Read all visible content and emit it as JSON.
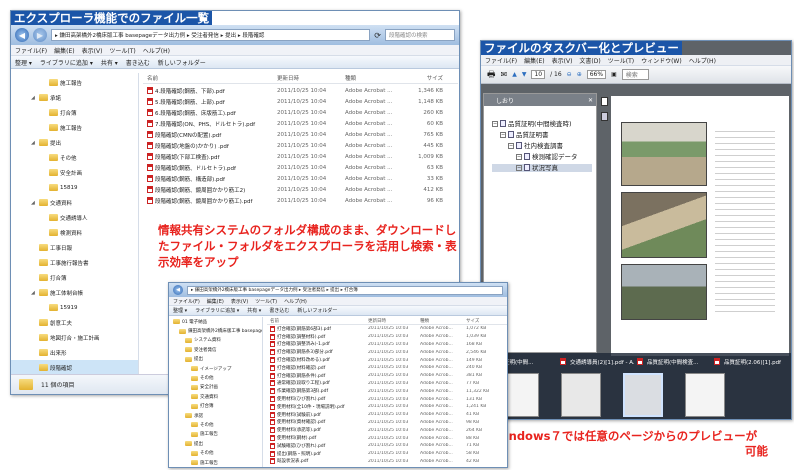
{
  "explorer_main": {
    "heading": "エクスプローラ機能でのファイル一覧",
    "address": "▸ 鎌田高架橋外2橋床版工事 basepageデータ出力例 ▸ 受注者発信 ▸ 提出 ▸ 段階確認",
    "search_placeholder": "段階確認の検索",
    "menu": [
      "ファイル(F)",
      "編集(E)",
      "表示(V)",
      "ツール(T)",
      "ヘルプ(H)"
    ],
    "commands": [
      "整理 ▾",
      "ライブラリに追加 ▾",
      "共有 ▾",
      "書き込む",
      "新しいフォルダー"
    ],
    "tree": [
      {
        "label": "施工報告",
        "level": 2,
        "exp": ""
      },
      {
        "label": "承諾",
        "level": 1,
        "exp": "◢"
      },
      {
        "label": "打合簿",
        "level": 2,
        "exp": ""
      },
      {
        "label": "施工報告",
        "level": 2,
        "exp": ""
      },
      {
        "label": "提出",
        "level": 1,
        "exp": "◢"
      },
      {
        "label": "その他",
        "level": 2,
        "exp": ""
      },
      {
        "label": "安全計画",
        "level": 2,
        "exp": ""
      },
      {
        "label": "15819",
        "level": 2,
        "exp": ""
      },
      {
        "label": "交通資料",
        "level": 1,
        "exp": "◢"
      },
      {
        "label": "交通誘導人",
        "level": 2,
        "exp": ""
      },
      {
        "label": "検測資料",
        "level": 2,
        "exp": ""
      },
      {
        "label": "工事日報",
        "level": 1,
        "exp": ""
      },
      {
        "label": "工事施行報告書",
        "level": 1,
        "exp": ""
      },
      {
        "label": "打合簿",
        "level": 1,
        "exp": ""
      },
      {
        "label": "施工体制台帳",
        "level": 1,
        "exp": "◢"
      },
      {
        "label": "15919",
        "level": 2,
        "exp": ""
      },
      {
        "label": "創意工夫",
        "level": 1,
        "exp": ""
      },
      {
        "label": "地図打合・施工計画",
        "level": 1,
        "exp": ""
      },
      {
        "label": "出来形",
        "level": 1,
        "exp": ""
      },
      {
        "label": "段階確認",
        "level": 1,
        "exp": "",
        "selected": true
      },
      {
        "label": "品質証明",
        "level": 1,
        "exp": ""
      },
      {
        "label": "報告",
        "level": 0,
        "exp": "◢"
      },
      {
        "label": "近隣・事後状態報告書",
        "level": 1,
        "exp": ""
      }
    ],
    "status": "11 個の項目",
    "columns": [
      "名前",
      "更新日時",
      "種類",
      "サイズ"
    ],
    "files": [
      {
        "name": "4.段階確認(鋼筋、下部).pdf",
        "date": "2011/10/25 10:04",
        "type": "Adobe Acrobat ...",
        "size": "1,346 KB"
      },
      {
        "name": "5.段階確認(鋼筋、上部).pdf",
        "date": "2011/10/25 10:04",
        "type": "Adobe Acrobat ...",
        "size": "1,148 KB"
      },
      {
        "name": "6.段階確認(鋼筋、床版筋工).pdf",
        "date": "2011/10/25 10:04",
        "type": "Adobe Acrobat ...",
        "size": "260 KB"
      },
      {
        "name": "7.段階確認(ON、PHS、ドルセトラ).pdf",
        "date": "2011/10/25 10:04",
        "type": "Adobe Acrobat ...",
        "size": "60 KB"
      },
      {
        "name": "段階確認(CMNの配置).pdf",
        "date": "2011/10/25 10:04",
        "type": "Adobe Acrobat ...",
        "size": "765 KB"
      },
      {
        "name": "段階確認(地盤の)かかり) .pdf",
        "date": "2011/10/25 10:04",
        "type": "Adobe Acrobat ...",
        "size": "445 KB"
      },
      {
        "name": "段階確認(下部工検査).pdf",
        "date": "2011/10/25 10:04",
        "type": "Adobe Acrobat ...",
        "size": "1,009 KB"
      },
      {
        "name": "段階確認(鋼筋、ドルセトラ).pdf",
        "date": "2011/10/25 10:04",
        "type": "Adobe Acrobat ...",
        "size": "63 KB"
      },
      {
        "name": "段階確認(鋼筋、構造部).pdf",
        "date": "2011/10/25 10:04",
        "type": "Adobe Acrobat ...",
        "size": "33 KB"
      },
      {
        "name": "段階確認(鋼筋、鏡周囲かかり筋工2)",
        "date": "2011/10/25 10:04",
        "type": "Adobe Acrobat ...",
        "size": "412 KB"
      },
      {
        "name": "段階確認(鋼筋、鏡周囲かかり筋工).pdf",
        "date": "2011/10/25 10:04",
        "type": "Adobe Acrobat ...",
        "size": "96 KB"
      }
    ]
  },
  "caption_main": "情報共有システムのフォルダ構成のまま、ダウンロードしたファイル・フォルダをエクスプローラを活用し検索・表示効率をアップ",
  "preview_win": {
    "heading": "ファイルのタスクバー化とプレビュー",
    "menu": [
      "ファイル(F)",
      "編集(E)",
      "表示(V)",
      "文書(D)",
      "ツール(T)",
      "ウィンドウ(W)",
      "ヘルプ(H)"
    ],
    "page": "10",
    "pages": "/ 16",
    "zoom": "66%",
    "search": "検索",
    "panel_title": "しおり",
    "bookmarks": [
      {
        "label": "品質証明(中間検査時)",
        "level": 0
      },
      {
        "label": "品質証明書",
        "level": 1
      },
      {
        "label": "社内検査調書",
        "level": 2
      },
      {
        "label": "検測確認データ",
        "level": 3
      },
      {
        "label": "状況写真",
        "level": 3,
        "selected": true
      }
    ],
    "tabs": [
      "品質証明(中間...",
      "交通誘導員(2)[1].pdf - A...",
      "品質証明(中間検査...",
      "品質証明(2.06)[1].pdf"
    ]
  },
  "caption_preview": [
    "Windows７では任意のページからのプレビューが",
    "可能"
  ],
  "explorer_second": {
    "address": "▸ 鎌田高架橋外2橋床版工事 basepageデータ出力例 ▸ 受注者発信 ▸ 提出 ▸ 打合簿",
    "menu": [
      "ファイル(F)",
      "編集(E)",
      "表示(V)",
      "ツール(T)",
      "ヘルプ(H)"
    ],
    "commands": [
      "整理 ▾",
      "ライブラリに追加 ▾",
      "共有 ▾",
      "書き込む",
      "新しいフォルダー"
    ],
    "columns": [
      "名前",
      "更新日時",
      "種類",
      "サイズ"
    ],
    "tree": [
      "01 電子納品",
      "鎌田高架橋外2橋床版工事 basepage",
      "システム資料",
      "受注者発信",
      "提出",
      "イメージアップ",
      "その他",
      "安全計画",
      "交通資料",
      "打合簿",
      "承諾",
      "その他",
      "施工報告",
      "提出",
      "その他",
      "施工報告"
    ],
    "files": [
      {
        "name": "打合確認(鋼筋第6部3).pdf",
        "date": "2011/10/25 10:03",
        "type": "Adobe Acrob...",
        "size": "1,072 KB"
      },
      {
        "name": "打合確認(調整材料).pdf",
        "date": "2011/10/25 10:03",
        "type": "Adobe Acrob...",
        "size": "1,039 KB"
      },
      {
        "name": "打合確認(調整済み)-1.pdf",
        "date": "2011/10/25 10:03",
        "type": "Adobe Acrob...",
        "size": "168 KB"
      },
      {
        "name": "打合確認(鋼筋条3)部分.pdf",
        "date": "2011/10/25 10:03",
        "type": "Adobe Acrob...",
        "size": "2,546 KB"
      },
      {
        "name": "打合確認(材料改める).pdf",
        "date": "2011/10/25 10:03",
        "type": "Adobe Acrob...",
        "size": "149 KB"
      },
      {
        "name": "打合確認(材料確認).pdf",
        "date": "2011/10/25 10:03",
        "type": "Adobe Acrob...",
        "size": "240 KB"
      },
      {
        "name": "打合確認(鋼筋条件).pdf",
        "date": "2011/10/25 10:03",
        "type": "Adobe Acrob...",
        "size": "381 KB"
      },
      {
        "name": "通常確認(段取り工程).pdf",
        "date": "2011/10/25 10:03",
        "type": "Adobe Acrob...",
        "size": "77 KB"
      },
      {
        "name": "作業確認(鋼筋第3部).pdf",
        "date": "2011/10/25 10:03",
        "type": "Adobe Acrob...",
        "size": "11,322 KB"
      },
      {
        "name": "使用材料(ひび割れ).pdf",
        "date": "2011/10/25 10:03",
        "type": "Adobe Acrob...",
        "size": "131 KB"
      },
      {
        "name": "使用材料(全10件・現場説明).pdf",
        "date": "2011/10/25 10:03",
        "type": "Adobe Acrob...",
        "size": "1,241 KB"
      },
      {
        "name": "使用材料(試験前).pdf",
        "date": "2011/10/25 10:03",
        "type": "Adobe Acrob...",
        "size": "41 KB"
      },
      {
        "name": "使用材料(資材確認).pdf",
        "date": "2011/10/25 10:03",
        "type": "Adobe Acrob...",
        "size": "98 KB"
      },
      {
        "name": "使用材料(承諾等).pdf",
        "date": "2011/10/25 10:03",
        "type": "Adobe Acrob...",
        "size": "264 KB"
      },
      {
        "name": "使用材料(鋼材).pdf",
        "date": "2011/10/25 10:03",
        "type": "Adobe Acrob...",
        "size": "88 KB"
      },
      {
        "name": "試験確認(ひび割れ).pdf",
        "date": "2011/10/25 10:03",
        "type": "Adobe Acrob...",
        "size": "71 KB"
      },
      {
        "name": "提出(鋼筋・照明).pdf",
        "date": "2011/10/25 10:03",
        "type": "Adobe Acrob...",
        "size": "58 KB"
      },
      {
        "name": "既設状況表.pdf",
        "date": "2011/10/25 10:03",
        "type": "Adobe Acrob...",
        "size": "42 KB"
      }
    ]
  }
}
